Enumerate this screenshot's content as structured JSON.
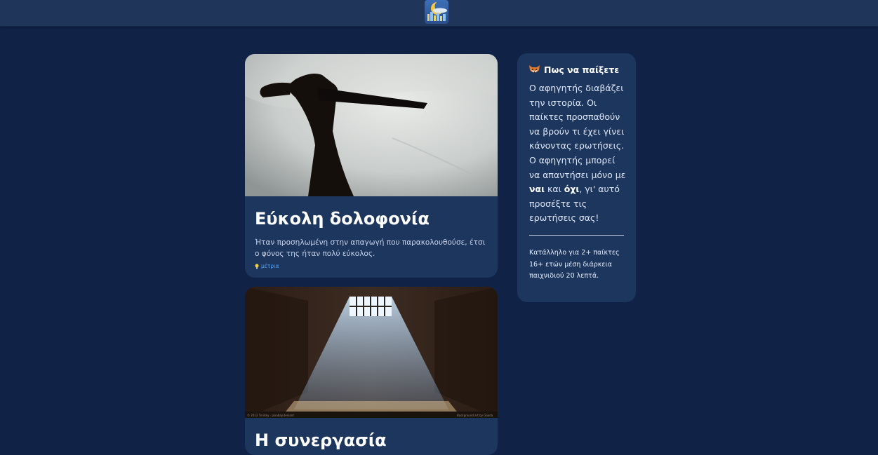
{
  "header": {
    "logo_icon": "crescent-moon-city-logo-icon"
  },
  "stories": [
    {
      "title": "Εύκολη δολοφονία",
      "description": "Ήταν προσηλωμένη στην απαγωγή που παρακολουθούσε, έτσι ο φόνος της ήταν πολύ εύκολος.",
      "tag": "μέτρια",
      "image_icon": "knife-silhouette-image"
    },
    {
      "title": "Η συνεργασία",
      "image_icon": "prison-cell-light-image",
      "image_caption_left": "© 2013 Tinilsky · pixabay.deviant",
      "image_caption_right": "Background art by Gaada"
    }
  ],
  "how_to_play": {
    "icon": "fox-face-icon",
    "heading": "Πως να παίξετε",
    "intro": "Ο αφηγητής διαβάζει την ιστορία. Οι παίκτες προσπαθούν να βρούν τι έχει γίνει κάνοντας ερωτήσεις. Ο αφηγητής μπορεί να απαντήσει μόνο με ",
    "yes_word": "ναι",
    "and_word": " και ",
    "no_word": "όχι",
    "outro": ", γι' αυτό προσέξτε τις ερωτήσεις σας!",
    "meta": "Κατάλληλο για 2+ παίκτες 16+ ετών μέση διάρκεια παιχνιδιού 20 λεπτά."
  },
  "colors": {
    "background": "#102347",
    "header": "#1f3559",
    "card": "#1d365e",
    "tag": "#4aa3ff"
  }
}
